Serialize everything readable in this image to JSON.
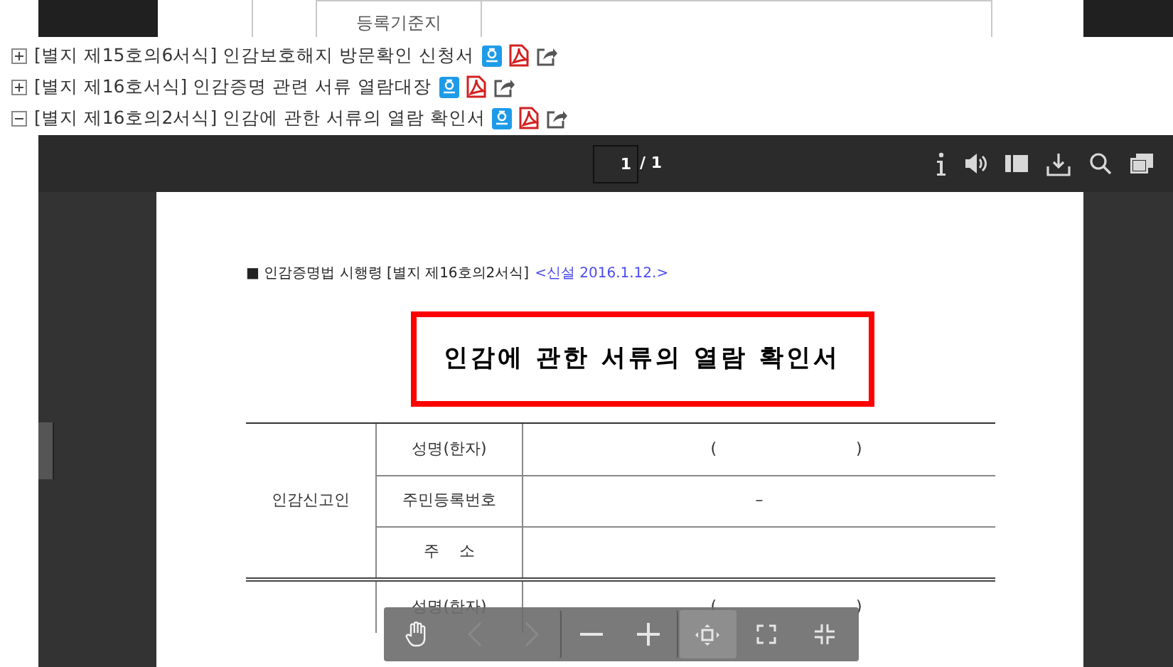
{
  "top_table": {
    "cell": "등록기준지"
  },
  "form_list": [
    {
      "title": "[별지 제15호의6서식] 인감보호해지 방문확인 신청서",
      "expanded": false
    },
    {
      "title": "[별지 제16호서식] 인감증명 관련 서류 열람대장",
      "expanded": false
    },
    {
      "title": "[별지 제16호의2서식] 인감에 관한 서류의 열람 확인서",
      "expanded": true
    }
  ],
  "viewer": {
    "page_input": "1",
    "page_total": "/ 1",
    "toolbar": [
      {
        "kind": "info"
      },
      {
        "kind": "speaker"
      },
      {
        "kind": "sidebar"
      },
      {
        "kind": "download"
      },
      {
        "kind": "search"
      },
      {
        "kind": "windows"
      }
    ],
    "zoom_bar": [
      {
        "kind": "hand",
        "selected": false
      },
      {
        "kind": "prev",
        "selected": false
      },
      {
        "kind": "next",
        "selected": false
      },
      {
        "kind": "zoom_out",
        "selected": false
      },
      {
        "kind": "zoom_in",
        "selected": false
      },
      {
        "kind": "fit",
        "selected": true
      },
      {
        "kind": "fullscreen",
        "selected": false
      },
      {
        "kind": "collapse",
        "selected": false
      }
    ]
  },
  "document": {
    "header": "■ 인감증명법 시행령 [별지 제16호의2서식]",
    "header_note": "<신설 2016.1.12.>",
    "title": "인감에 관한 서류의 열람 확인서",
    "sections": [
      {
        "label": "인감신고인",
        "rows": [
          {
            "kind": "paren",
            "label": "성명(한자)",
            "open": "(",
            "close": ")"
          },
          {
            "kind": "text",
            "label": "주민등록번호",
            "value": "–"
          },
          {
            "kind": "text",
            "label": "주    소"
          }
        ]
      },
      {
        "rows": [
          {
            "kind": "paren",
            "label": "성명(한자)",
            "open": "(",
            "close": ")"
          }
        ]
      }
    ]
  }
}
